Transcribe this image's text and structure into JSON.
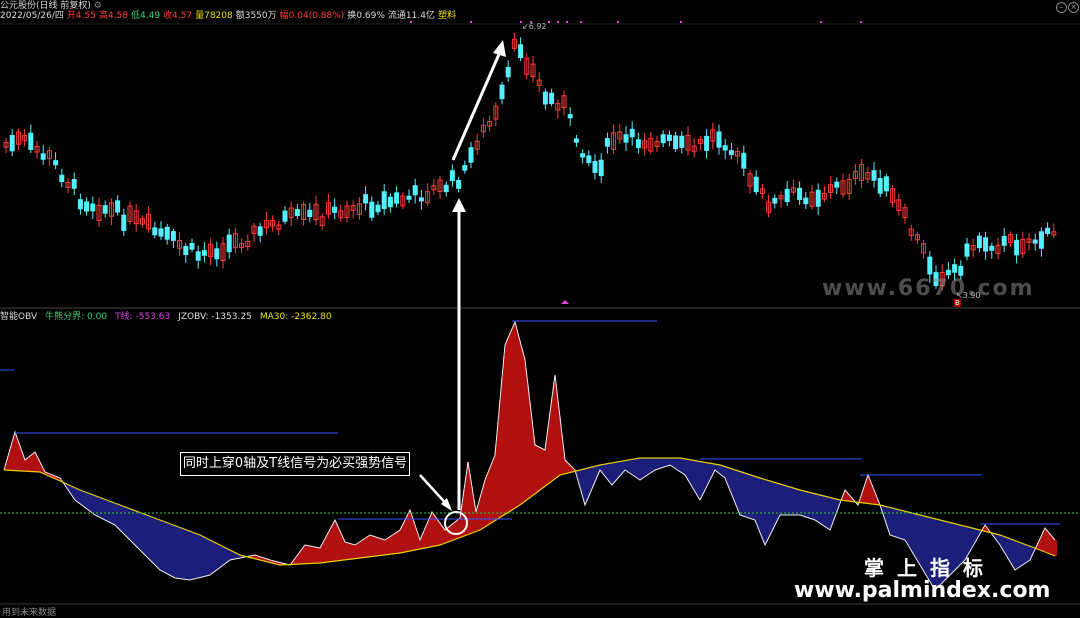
{
  "header": {
    "title": "公元股份(日线 前复权)",
    "info": [
      {
        "text": "2022/05/26/四",
        "color": "#dddddd"
      },
      {
        "text": "开4.55",
        "color": "#ff3b3b"
      },
      {
        "text": "高4.58",
        "color": "#ff3b3b"
      },
      {
        "text": "低4.49",
        "color": "#33d17a"
      },
      {
        "text": "收4.57",
        "color": "#ff3b3b"
      },
      {
        "text": "量78208",
        "color": "#e8e000"
      },
      {
        "text": "额3550万",
        "color": "#dddddd"
      },
      {
        "text": "幅0.04(0.88%)",
        "color": "#ff3b3b"
      },
      {
        "text": "换0.69%",
        "color": "#dddddd"
      },
      {
        "text": "流通11.4亿",
        "color": "#dddddd"
      },
      {
        "text": "塑料",
        "color": "#e8e000"
      }
    ],
    "price_high_label": "6.92",
    "price_low_label": "3.90",
    "low_badge": "B"
  },
  "indicator": {
    "items": [
      {
        "text": "智能OBV",
        "color": "#dddddd"
      },
      {
        "text": "牛熊分界: 0.00",
        "color": "#33d17a"
      },
      {
        "text": "T线: -553.63",
        "color": "#e040e0"
      },
      {
        "text": "JZOBV: -1353.25",
        "color": "#dddddd"
      },
      {
        "text": "MA30: -2362.80",
        "color": "#e8e000"
      }
    ]
  },
  "annotation": {
    "callout": "同时上穿0轴及T线信号为必买强势信号"
  },
  "watermarks": {
    "top": "www.6670.com",
    "cn": "掌上指标",
    "url": "www.palmindex.com"
  },
  "footer": {
    "note": "用到未来数据"
  },
  "colors": {
    "up": "#ff3b3b",
    "down": "#54f0ff",
    "red_fill": "#b01010",
    "blue_fill": "#1c1f7a",
    "ma_line": "#e8d000",
    "zero_line": "#33cc33",
    "t_line": "#3355ff"
  }
}
